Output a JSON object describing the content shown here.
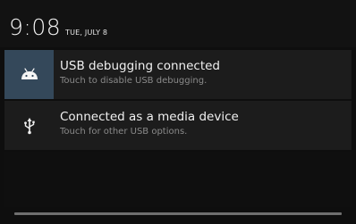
{
  "status": {
    "time": "9:08",
    "date": "TUE, JULY 8"
  },
  "notifications": [
    {
      "title": "USB debugging connected",
      "subtitle": "Touch to disable USB debugging.",
      "icon": "android-icon"
    },
    {
      "title": "Connected as a media device",
      "subtitle": "Touch for other USB options.",
      "icon": "usb-icon"
    }
  ],
  "colors": {
    "background": "#0e0e0e",
    "notification_bg": "#1c1c1c",
    "debug_icon_bg": "#34485a",
    "title_text": "#f0f0f0",
    "subtitle_text": "#8a8a8a"
  }
}
